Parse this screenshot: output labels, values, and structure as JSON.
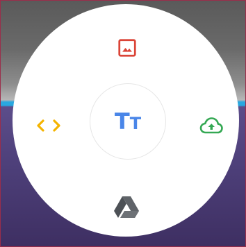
{
  "radial_menu": {
    "center": {
      "icon": "text-format-icon",
      "label_big": "T",
      "label_small": "T",
      "color": "#4a86e8"
    },
    "options": [
      {
        "icon": "image-icon",
        "color": "#db4437"
      },
      {
        "icon": "code-icon",
        "color": "#f4b400"
      },
      {
        "icon": "cloud-upload-icon",
        "color": "#34a853"
      },
      {
        "icon": "google-drive-icon",
        "color": "#5f6368"
      }
    ]
  }
}
